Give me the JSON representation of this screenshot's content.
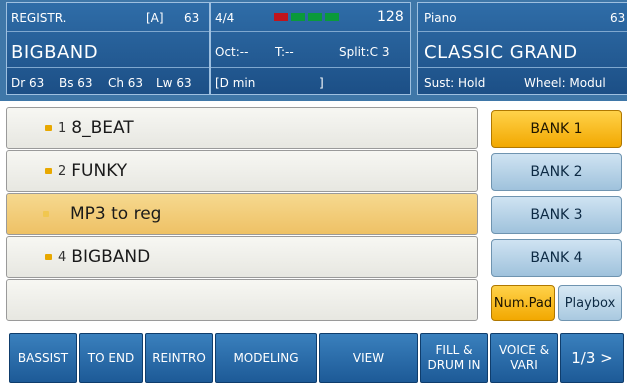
{
  "registration": {
    "label": "REGISTR.",
    "bank": "[A]",
    "number": "63",
    "name": "BIGBAND",
    "parts": [
      "Dr 63",
      "Bs 63",
      "Ch 63",
      "Lw 63"
    ]
  },
  "status": {
    "time_signature": "4/4",
    "tempo": "128",
    "octave": "Oct:--",
    "transpose": "T:--",
    "split": "Split:C 3",
    "chord": "[D min",
    "chord_close": "]",
    "meter_colors": [
      "#c0141c",
      "#0a9a3a",
      "#0a9a3a",
      "#0a9a3a"
    ]
  },
  "voice": {
    "label": "Piano",
    "number": "63",
    "name": "CLASSIC GRAND",
    "sustain": "Sust: Hold",
    "wheel": "Wheel: Modul"
  },
  "list": {
    "items": [
      {
        "num": "1",
        "name": "8_BEAT",
        "selected": false
      },
      {
        "num": "2",
        "name": "FUNKY",
        "selected": false
      },
      {
        "num": "",
        "name": "MP3 to reg",
        "selected": true
      },
      {
        "num": "4",
        "name": "BIGBAND",
        "selected": false
      }
    ]
  },
  "banks": [
    {
      "label": "BANK 1",
      "active": true
    },
    {
      "label": "BANK 2",
      "active": false
    },
    {
      "label": "BANK 3",
      "active": false
    },
    {
      "label": "BANK 4",
      "active": false
    }
  ],
  "side_buttons": {
    "numpad": "Num.Pad",
    "playbox": "Playbox"
  },
  "bottom_buttons": [
    {
      "line1": "BASSIST",
      "line2": ""
    },
    {
      "line1": "TO END",
      "line2": ""
    },
    {
      "line1": "REINTRO",
      "line2": ""
    },
    {
      "line1": "MODELING",
      "line2": ""
    },
    {
      "line1": "VIEW",
      "line2": ""
    },
    {
      "line1": "FILL &",
      "line2": "DRUM IN"
    },
    {
      "line1": "VOICE &",
      "line2": "VARI"
    },
    {
      "line1": "1/3 >",
      "line2": ""
    }
  ]
}
